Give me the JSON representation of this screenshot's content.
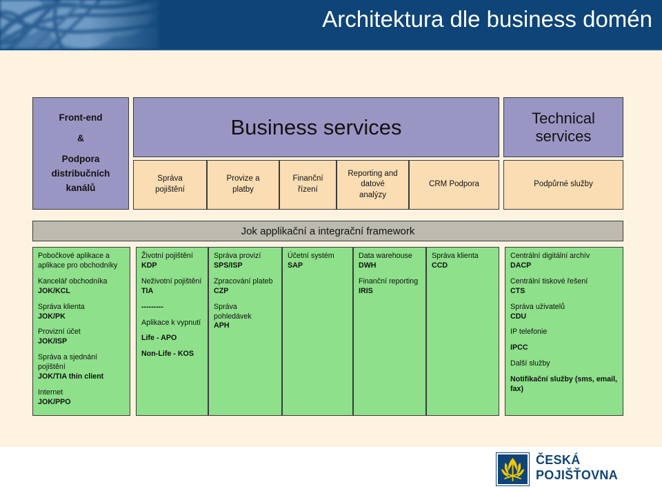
{
  "header": {
    "title": "Architektura dle business domén",
    "background_color": "#0e4477",
    "title_color": "#ffffff"
  },
  "colors": {
    "page_background": "#fdf3e0",
    "domain_header": "#9a96c4",
    "service_cell": "#fbddb4",
    "application_cell": "#8ee08a",
    "framework_band": "#bdbab0",
    "brand_blue": "#0e4477",
    "brand_gold": "#f2c800"
  },
  "domains": {
    "frontend": {
      "line1": "Front-end",
      "line2": "&",
      "line3": "Podpora",
      "line4": "distribučních",
      "line5": "kanálů"
    },
    "business": {
      "title": "Business services"
    },
    "technical": {
      "line1": "Technical",
      "line2": "services"
    }
  },
  "services": [
    {
      "line1": "Správa",
      "line2": "pojištění"
    },
    {
      "line1": "Provize a",
      "line2": "platby"
    },
    {
      "line1": "Finanční",
      "line2": "řízení"
    },
    {
      "line1": "Reporting and",
      "line2": "datové",
      "line3": "analýzy"
    },
    {
      "line1": "CRM Podpora",
      "line2": ""
    }
  ],
  "technical_service": {
    "line1": "Podpůrné služby",
    "line2": ""
  },
  "framework": {
    "label": "Jok applikační a integrační framework"
  },
  "application_columns": [
    {
      "name": "frontend-applications",
      "groups": [
        {
          "label": "Pobočkové aplikace a aplikace pro obchodníky",
          "code": ""
        },
        {
          "label": "Kancelář obchodníka",
          "code": "JOK/KCL"
        },
        {
          "label": "Správa klienta",
          "code": "JOK/PK"
        },
        {
          "label": "Provizní účet",
          "code": "JOK/ISP"
        },
        {
          "label": "Správa a sjednání pojištění",
          "code": "JOK/TIA  thin client"
        },
        {
          "label": "Internet",
          "code": "JOK/PPO"
        }
      ]
    },
    {
      "name": "insurance-administration",
      "groups": [
        {
          "label": "Životní pojištění",
          "code": "KDP"
        },
        {
          "label": "Neživotní pojištění",
          "code": "TIA"
        },
        {
          "label": "",
          "code": "---------"
        },
        {
          "label": "Aplikace k vypnutí",
          "code": ""
        },
        {
          "label": "",
          "code": "Life - APO"
        },
        {
          "label": "",
          "code": "Non-Life - KOS"
        }
      ]
    },
    {
      "name": "commissions-and-payments",
      "groups": [
        {
          "label": "Správa provizí",
          "code": "SPS/ISP"
        },
        {
          "label": "Zpracování plateb",
          "code": "CZP"
        },
        {
          "label": "Správa pohledávek",
          "code": "APH"
        }
      ]
    },
    {
      "name": "financial-management",
      "groups": [
        {
          "label": "Účetní systém",
          "code": "SAP"
        }
      ]
    },
    {
      "name": "reporting-and-analytics",
      "groups": [
        {
          "label": "Data warehouse",
          "code": "DWH"
        },
        {
          "label": "Finanční reporting",
          "code": "IRIS"
        }
      ]
    },
    {
      "name": "crm-support",
      "groups": [
        {
          "label": "Správa klienta",
          "code": "CCD"
        }
      ]
    },
    {
      "name": "technical-support-services",
      "groups": [
        {
          "label": "Centrální digitální archív",
          "code": "DACP"
        },
        {
          "label": "Centrální tiskové řešení",
          "code": "CTS"
        },
        {
          "label": "Správa uživatelů",
          "code": "CDU"
        },
        {
          "label": "IP telefonie",
          "code": ""
        },
        {
          "label": "",
          "code": "IPCC"
        },
        {
          "label": "Další služby",
          "code": ""
        },
        {
          "label": "",
          "code": "Notifikační služby (sms, email, fax)"
        }
      ]
    }
  ],
  "logo": {
    "line1": "ČESKÁ",
    "line2": "POJIŠŤOVNA"
  }
}
